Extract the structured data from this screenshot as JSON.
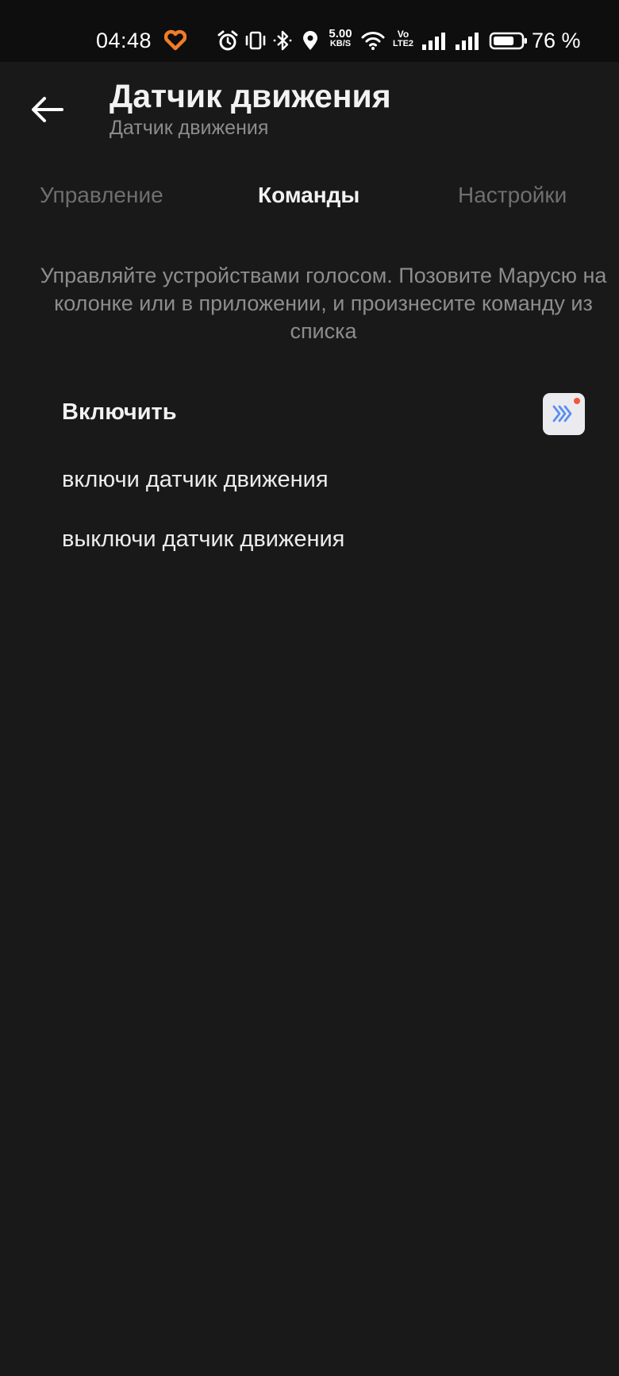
{
  "status_bar": {
    "time": "04:48",
    "network_speed_value": "5.00",
    "network_speed_unit": "KB/S",
    "volte_line1": "Vo",
    "volte_line2": "LTE2",
    "battery_percent": "76 %",
    "battery_level": 0.76,
    "icons": [
      "heart-logo-icon",
      "alarm-icon",
      "vibrate-icon",
      "bluetooth-icon",
      "location-icon",
      "wifi-icon",
      "volte-icon",
      "signal-icon",
      "signal-icon",
      "battery-icon"
    ],
    "accent_color": "#f07d28"
  },
  "header": {
    "back_icon": "arrow-left-icon",
    "title": "Датчик движения",
    "subtitle": "Датчик движения"
  },
  "tabs": [
    {
      "label": "Управление",
      "active": false
    },
    {
      "label": "Команды",
      "active": true
    },
    {
      "label": "Настройки",
      "active": false
    }
  ],
  "description": "Управляйте устройствами голосом. Позовите Марусю на колонке или в приложении, и произнесите команду из списка",
  "commands_section": {
    "group_title": "Включить",
    "device_icon": "device-chevrons-icon",
    "device_icon_color": "#5b8ef0",
    "device_dot_color": "#f2573c",
    "commands": [
      "включи датчик движения",
      "выключи датчик движения"
    ]
  },
  "colors": {
    "background": "#191919",
    "status_bar": "#0e0e0e",
    "text_primary": "#f2f2f2",
    "text_secondary": "#8c8c8c",
    "tab_inactive": "#6f6f6f"
  }
}
